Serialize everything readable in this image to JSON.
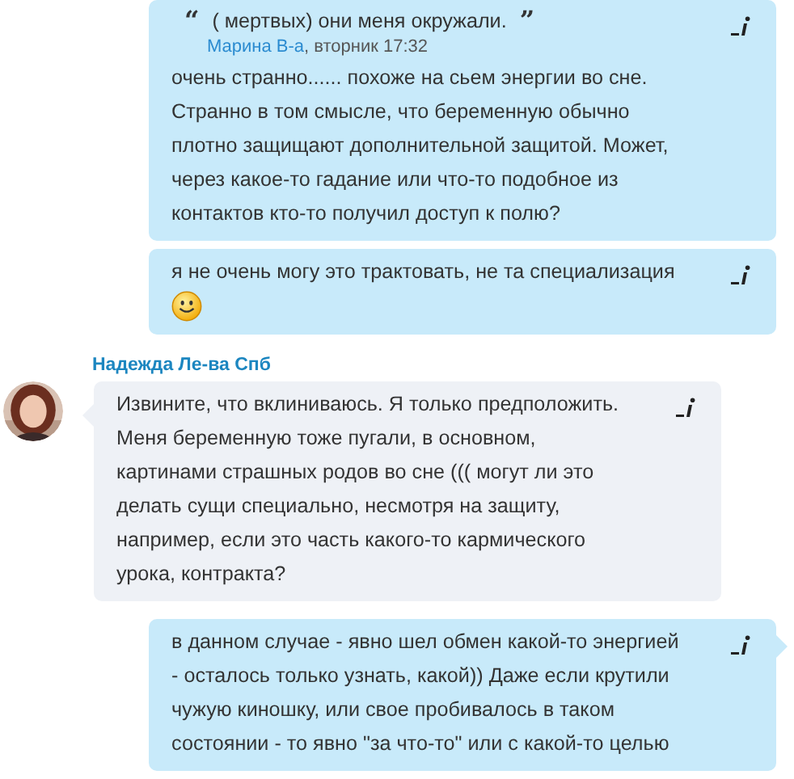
{
  "messages": [
    {
      "kind": "outgoing",
      "tail": false,
      "quote": {
        "open_mark": "“",
        "text": "( мертвых) они меня окружали.",
        "close_mark": "”",
        "author": "Марина В-а",
        "time": ", вторник 17:32"
      },
      "text": "очень странно...... похоже на сьем энергии во сне.\nСтранно в том смысле, что беременную обычно\nплотно защищают дополнительной защитой. Может,\nчерез какое-то гадание или что-то подобное из\nконтактов кто-то получил доступ к полю?"
    },
    {
      "kind": "outgoing",
      "tail": false,
      "emoticon": true,
      "text": "я не очень могу это трактовать, не та специализация"
    },
    {
      "kind": "incoming",
      "tail": true,
      "sender": "Надежда Ле-ва Спб",
      "text": "Извините, что вклиниваюсь. Я только предположить.\nМеня беременную тоже пугали, в основном,\nкартинами страшных родов во сне ((( могут ли это\nделать сущи специально, несмотря на защиту,\nнапример, если это часть какого-то кармического\nурока, контракта?"
    },
    {
      "kind": "outgoing",
      "tail": true,
      "text": "в данном случае - явно шел обмен какой-то энергией\n- осталось только узнать, какой))  Даже если крутили\nчужую киношку, или свое пробивалось в таком\nсостоянии - то явно \"за что-то\" или с какой-то целью"
    }
  ]
}
